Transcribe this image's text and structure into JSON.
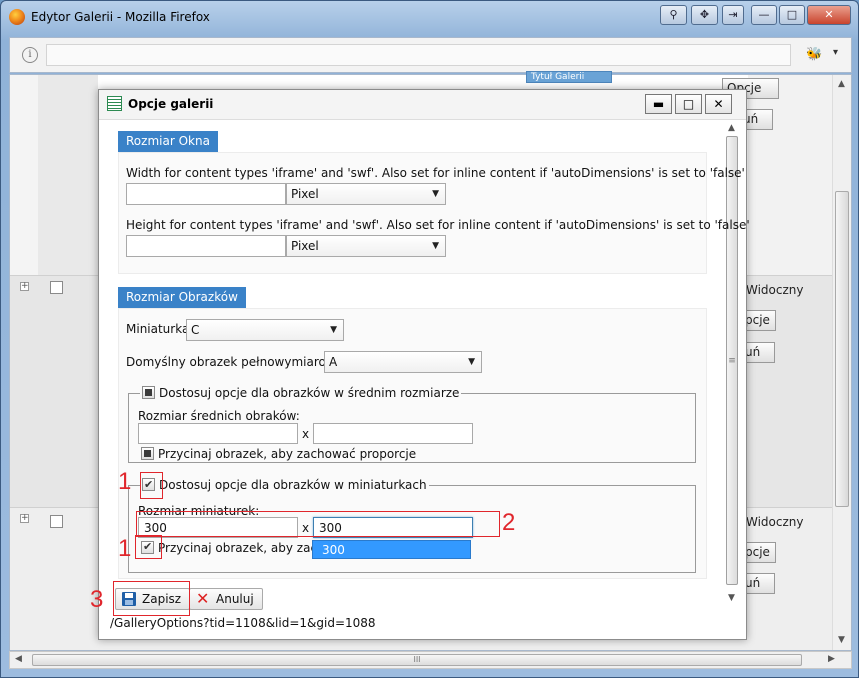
{
  "browser": {
    "title": "Edytor Galerii - Mozilla Firefox",
    "win_buttons": {
      "minimize": "—",
      "maximize": "□",
      "close": "✕"
    },
    "info_icon": "i",
    "addon_icon": "🐝",
    "menu_arrow": "▾"
  },
  "background": {
    "btn_top": "Opcje",
    "btn_partial": "uń",
    "widoczny": "Widoczny",
    "opcje_partial": "pcje",
    "top_tab_partial": "Tytuł Galerii"
  },
  "dialog": {
    "title": "Opcje galerii",
    "buttons": {
      "minimize": "▬",
      "maximize": "□",
      "close": "✕"
    },
    "section1": {
      "header": "Rozmiar Okna",
      "width_label": "Width for content types 'iframe' and 'swf'. Also set for inline content if 'autoDimensions' is set to 'false'",
      "width_value": "",
      "width_unit": "Pixel",
      "height_label": "Height for content types 'iframe' and 'swf'. Also set for inline content if 'autoDimensions' is set to 'false'",
      "height_value": "",
      "height_unit": "Pixel"
    },
    "section2": {
      "header": "Rozmiar Obrazków",
      "thumb_label": "Miniaturka:",
      "thumb_value": "C",
      "default_label": "Domyślny obrazek pełnowymiarowy:",
      "default_value": "A",
      "medium_legend": "Dostosuj opcje dla obrazków w średnim rozmiarze",
      "medium_size_label": "Rozmiar średnich obraków:",
      "medium_w": "",
      "medium_h": "",
      "x_sep": "x",
      "medium_crop": "Przycinaj obrazek, aby zachować proporcje",
      "mini_legend": "Dostosuj opcje dla obrazków w miniaturkach",
      "mini_size_label": "Rozmiar miniaturek:",
      "mini_w": "300",
      "mini_h": "300",
      "mini_crop": "Przycinaj obrazek, aby zachować proporcje",
      "autocomplete_option": "300"
    },
    "save_label": "Zapisz",
    "cancel_label": "Anuluj"
  },
  "status_url": "/GalleryOptions?tid=1108&lid=1&gid=1088",
  "annotations": {
    "n1": "1",
    "n2": "2",
    "n3": "3",
    "color": "#e0262c"
  },
  "colors": {
    "section_header": "#3a82c8",
    "autocomplete": "#3399ff"
  }
}
